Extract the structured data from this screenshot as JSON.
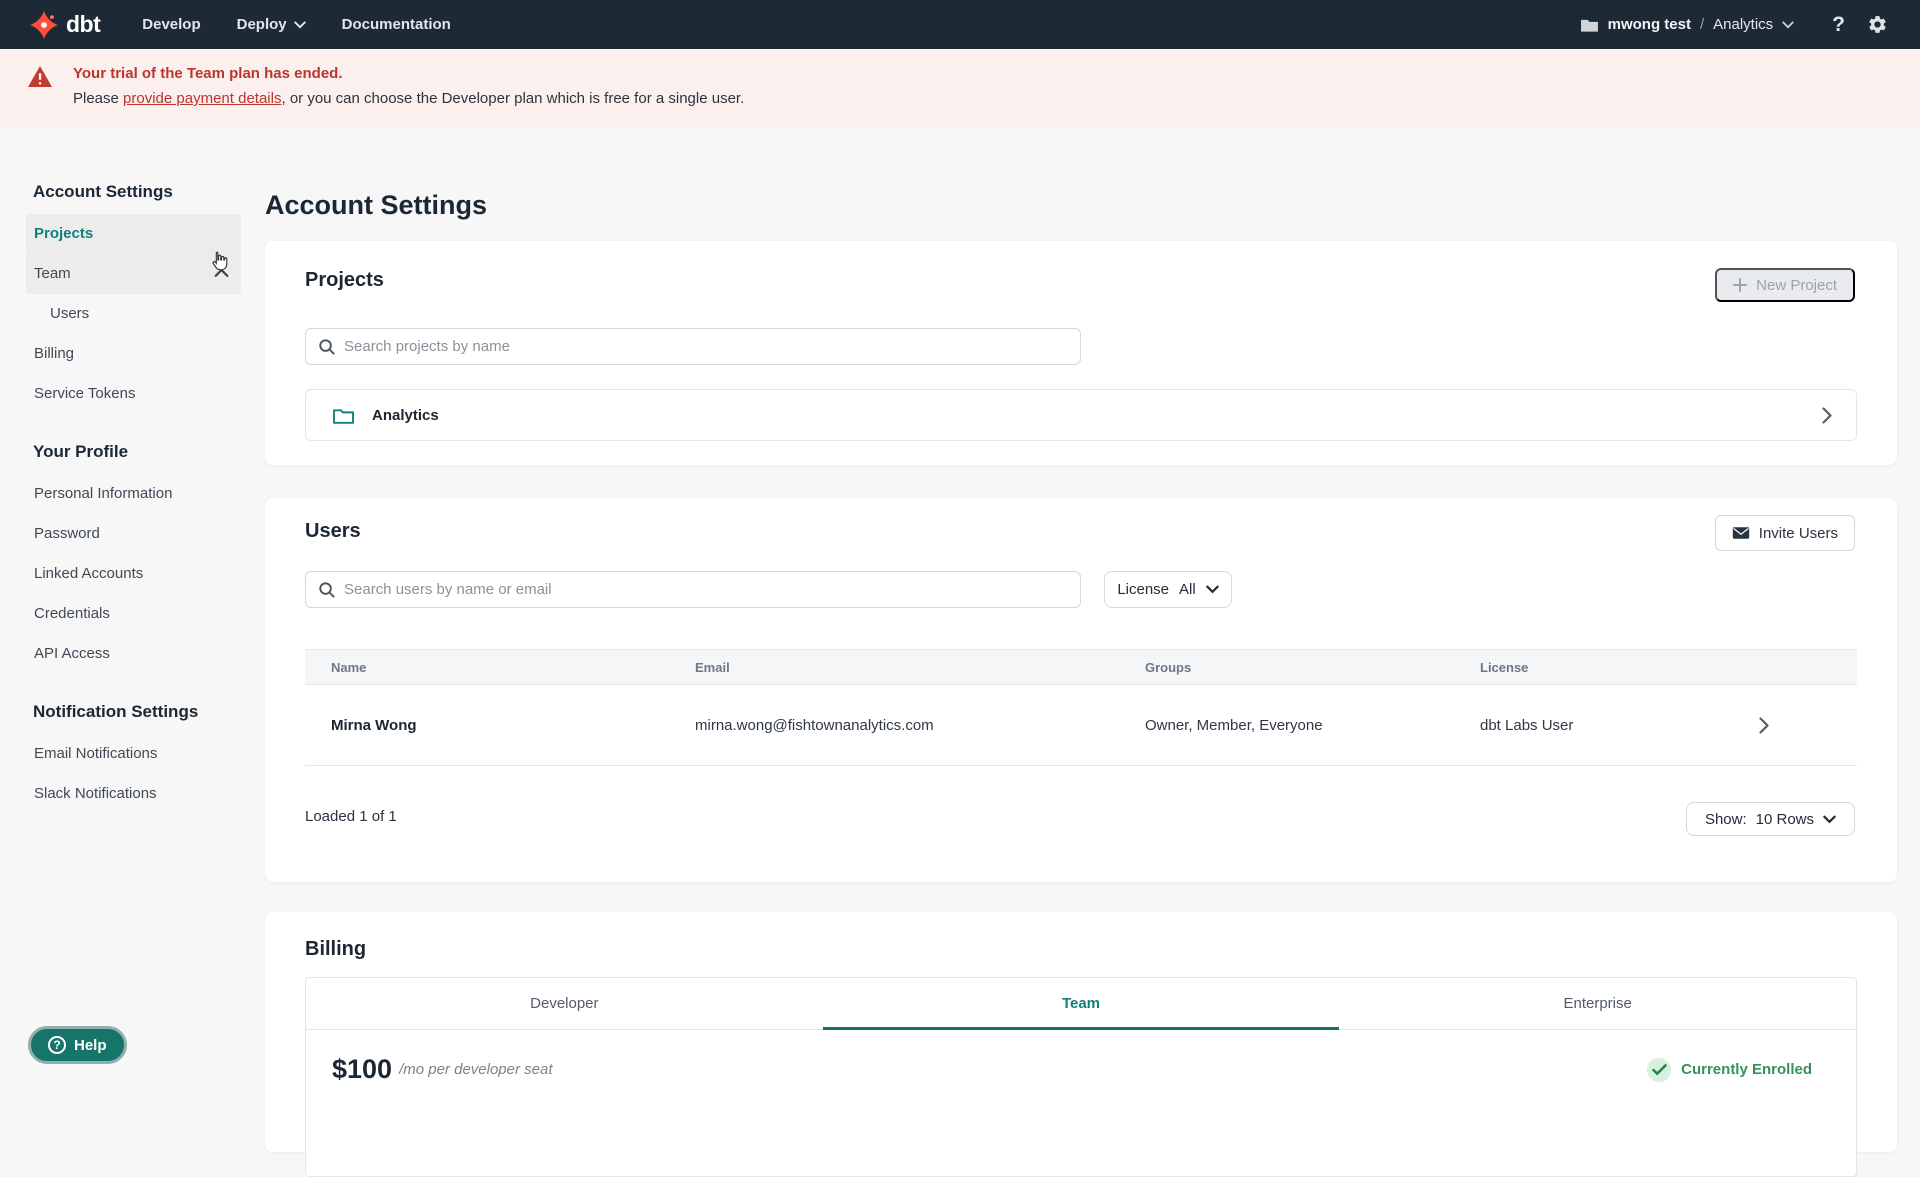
{
  "nav": {
    "logo_text": "dbt",
    "menu": {
      "develop": "Develop",
      "deploy": "Deploy",
      "documentation": "Documentation"
    },
    "account_name": "mwong test",
    "separator": "/",
    "project_name": "Analytics",
    "help_glyph": "?"
  },
  "banner": {
    "title": "Your trial of the Team plan has ended.",
    "body_prefix": "Please ",
    "link_text": "provide payment details",
    "body_suffix": ", or you can choose the Developer plan which is free for a single user."
  },
  "sidebar": {
    "sections": [
      {
        "heading": "Account Settings",
        "items": [
          {
            "label": "Projects"
          },
          {
            "label": "Team"
          },
          {
            "label": "Users"
          },
          {
            "label": "Billing"
          },
          {
            "label": "Service Tokens"
          }
        ]
      },
      {
        "heading": "Your Profile",
        "items": [
          {
            "label": "Personal Information"
          },
          {
            "label": "Password"
          },
          {
            "label": "Linked Accounts"
          },
          {
            "label": "Credentials"
          },
          {
            "label": "API Access"
          }
        ]
      },
      {
        "heading": "Notification Settings",
        "items": [
          {
            "label": "Email Notifications"
          },
          {
            "label": "Slack Notifications"
          }
        ]
      }
    ]
  },
  "main": {
    "title": "Account Settings",
    "projects": {
      "heading": "Projects",
      "new_button": "New Project",
      "search_placeholder": "Search projects by name",
      "rows": [
        {
          "name": "Analytics"
        }
      ]
    },
    "users": {
      "heading": "Users",
      "invite_button": "Invite Users",
      "search_placeholder": "Search users by name or email",
      "license_filter_label": "License",
      "license_filter_value": "All",
      "columns": {
        "name": "Name",
        "email": "Email",
        "groups": "Groups",
        "license": "License"
      },
      "rows": [
        {
          "name": "Mirna Wong",
          "email": "mirna.wong@fishtownanalytics.com",
          "groups": "Owner, Member, Everyone",
          "license": "dbt Labs User"
        }
      ],
      "loaded_text": "Loaded 1 of 1",
      "show_label": "Show:",
      "show_value": "10 Rows"
    },
    "billing": {
      "heading": "Billing",
      "tabs": [
        {
          "label": "Developer"
        },
        {
          "label": "Team"
        },
        {
          "label": "Enterprise"
        }
      ],
      "price": "$100",
      "price_suffix": "/mo per developer seat",
      "enrolled_text": "Currently Enrolled"
    }
  },
  "help_button": {
    "label": "Help",
    "glyph": "?"
  },
  "icons": {
    "dbt-logo": "orange four-point star",
    "folder": "folder",
    "search": "magnifier",
    "envelope": "mail",
    "warning": "red triangle exclamation",
    "check": "green check",
    "gear": "settings gear",
    "chevron": "chevron"
  },
  "colors": {
    "nav_bg": "#1e2936",
    "brand_orange": "#ff4f38",
    "accent_teal": "#12807a",
    "banner_bg": "#fcf0ef",
    "banner_red": "#ba362d",
    "enrolled_green": "#36915a",
    "page_bg": "#f7f7f8"
  }
}
